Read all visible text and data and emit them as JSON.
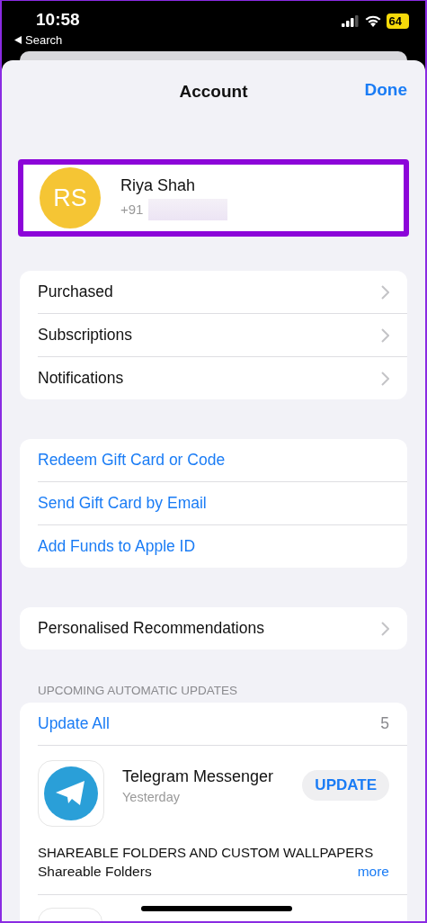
{
  "status_bar": {
    "time": "10:58",
    "back_label": "Search",
    "battery": "64"
  },
  "nav": {
    "title": "Account",
    "done": "Done"
  },
  "profile": {
    "initials": "RS",
    "name": "Riya Shah",
    "phone": "+91",
    "highlighted": true
  },
  "menu_groups": [
    {
      "items": [
        {
          "label": "Purchased",
          "kind": "nav"
        },
        {
          "label": "Subscriptions",
          "kind": "nav"
        },
        {
          "label": "Notifications",
          "kind": "nav"
        }
      ]
    },
    {
      "items": [
        {
          "label": "Redeem Gift Card or Code",
          "kind": "link"
        },
        {
          "label": "Send Gift Card by Email",
          "kind": "link"
        },
        {
          "label": "Add Funds to Apple ID",
          "kind": "link"
        }
      ]
    },
    {
      "items": [
        {
          "label": "Personalised Recommendations",
          "kind": "nav"
        }
      ]
    }
  ],
  "updates": {
    "header": "UPCOMING AUTOMATIC UPDATES",
    "update_all": "Update All",
    "count": "5",
    "apps": [
      {
        "name": "Telegram Messenger",
        "date": "Yesterday",
        "button": "UPDATE",
        "notes_title": "SHAREABLE FOLDERS AND CUSTOM WALLPAPERS",
        "notes": "Shareable Folders",
        "more": "more"
      }
    ]
  }
}
